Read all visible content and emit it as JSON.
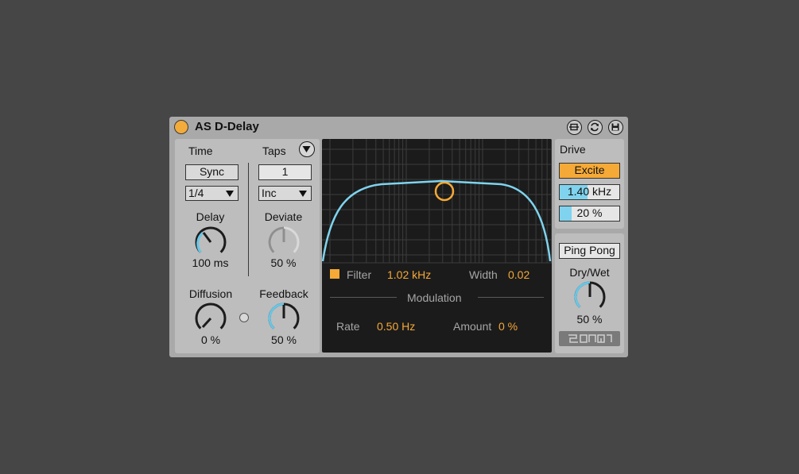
{
  "device": {
    "title": "AS D-Delay",
    "icons": [
      "hot-swap-icon",
      "refresh-icon",
      "save-icon"
    ]
  },
  "time": {
    "heading": "Time",
    "sync_label": "Sync",
    "division_value": "1/4",
    "delay_label": "Delay",
    "delay_value": "100 ms"
  },
  "taps": {
    "heading": "Taps",
    "count_value": "1",
    "mode_value": "Inc",
    "deviate_label": "Deviate",
    "deviate_value": "50 %"
  },
  "diffusion": {
    "label": "Diffusion",
    "value": "0 %"
  },
  "feedback": {
    "label": "Feedback",
    "value": "50 %"
  },
  "filter": {
    "label": "Filter",
    "freq_value": "1.02 kHz",
    "width_label": "Width",
    "width_value": "0.02"
  },
  "modulation": {
    "heading": "Modulation",
    "rate_label": "Rate",
    "rate_value": "0.50 Hz",
    "amount_label": "Amount",
    "amount_value": "0 %"
  },
  "drive": {
    "heading": "Drive",
    "mode_value": "Excite",
    "freq_value": "1.40 kHz",
    "amount_value": "20 %"
  },
  "output": {
    "ping_pong_label": "Ping Pong",
    "drywet_label": "Dry/Wet",
    "drywet_value": "50 %"
  },
  "colors": {
    "accent_orange": "#f5a937",
    "curve_blue": "#7fd3ee",
    "display_bg": "#1b1b1b"
  }
}
